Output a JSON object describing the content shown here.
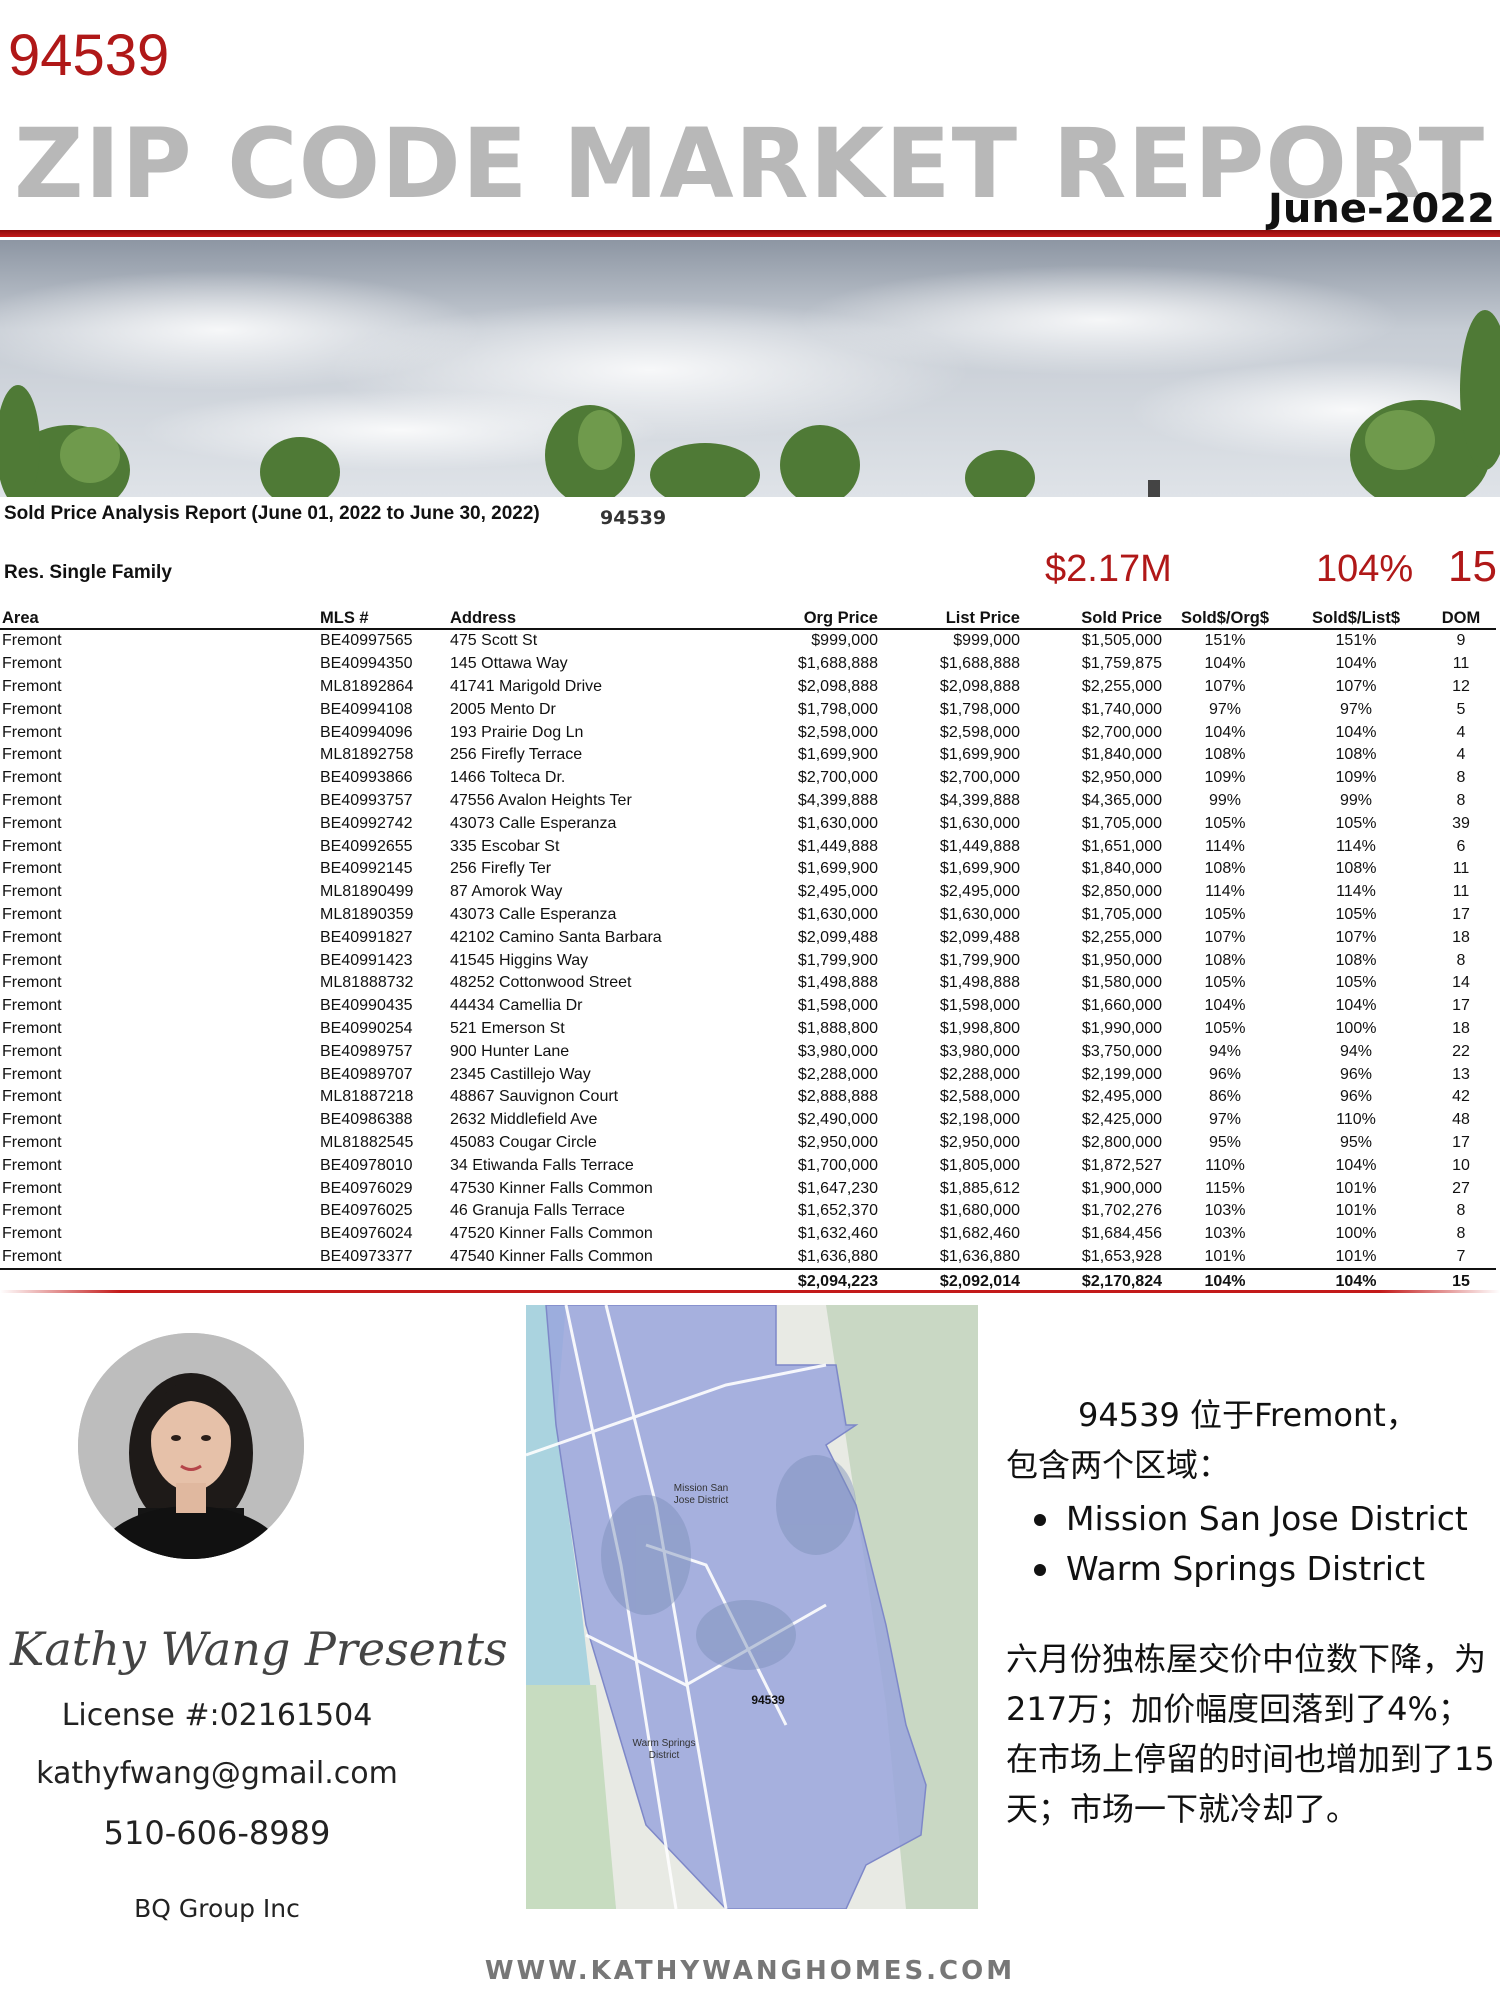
{
  "header": {
    "zip": "94539",
    "title": "ZIP CODE MARKET REPORT",
    "date": "June-2022"
  },
  "report": {
    "title": "Sold Price Analysis Report (June 01, 2022 to June 30, 2022)",
    "zip": "94539",
    "segment": "Res. Single Family",
    "highlights": {
      "median_price": "$2.17M",
      "sold_over_list": "104%",
      "dom": "15"
    },
    "columns": [
      "Area",
      "MLS #",
      "Address",
      "Org Price",
      "List Price",
      "Sold Price",
      "Sold$/Org$",
      "Sold$/List$",
      "DOM"
    ],
    "rows": [
      [
        "Fremont",
        "BE40997565",
        "475 Scott St",
        "$999,000",
        "$999,000",
        "$1,505,000",
        "151%",
        "151%",
        "9"
      ],
      [
        "Fremont",
        "BE40994350",
        "145 Ottawa Way",
        "$1,688,888",
        "$1,688,888",
        "$1,759,875",
        "104%",
        "104%",
        "11"
      ],
      [
        "Fremont",
        "ML81892864",
        "41741 Marigold Drive",
        "$2,098,888",
        "$2,098,888",
        "$2,255,000",
        "107%",
        "107%",
        "12"
      ],
      [
        "Fremont",
        "BE40994108",
        "2005 Mento Dr",
        "$1,798,000",
        "$1,798,000",
        "$1,740,000",
        "97%",
        "97%",
        "5"
      ],
      [
        "Fremont",
        "BE40994096",
        "193 Prairie Dog Ln",
        "$2,598,000",
        "$2,598,000",
        "$2,700,000",
        "104%",
        "104%",
        "4"
      ],
      [
        "Fremont",
        "ML81892758",
        "256 Firefly Terrace",
        "$1,699,900",
        "$1,699,900",
        "$1,840,000",
        "108%",
        "108%",
        "4"
      ],
      [
        "Fremont",
        "BE40993866",
        "1466 Tolteca Dr.",
        "$2,700,000",
        "$2,700,000",
        "$2,950,000",
        "109%",
        "109%",
        "8"
      ],
      [
        "Fremont",
        "BE40993757",
        "47556 Avalon Heights Ter",
        "$4,399,888",
        "$4,399,888",
        "$4,365,000",
        "99%",
        "99%",
        "8"
      ],
      [
        "Fremont",
        "BE40992742",
        "43073 Calle Esperanza",
        "$1,630,000",
        "$1,630,000",
        "$1,705,000",
        "105%",
        "105%",
        "39"
      ],
      [
        "Fremont",
        "BE40992655",
        "335 Escobar St",
        "$1,449,888",
        "$1,449,888",
        "$1,651,000",
        "114%",
        "114%",
        "6"
      ],
      [
        "Fremont",
        "BE40992145",
        "256 Firefly Ter",
        "$1,699,900",
        "$1,699,900",
        "$1,840,000",
        "108%",
        "108%",
        "11"
      ],
      [
        "Fremont",
        "ML81890499",
        "87 Amorok Way",
        "$2,495,000",
        "$2,495,000",
        "$2,850,000",
        "114%",
        "114%",
        "11"
      ],
      [
        "Fremont",
        "ML81890359",
        "43073 Calle Esperanza",
        "$1,630,000",
        "$1,630,000",
        "$1,705,000",
        "105%",
        "105%",
        "17"
      ],
      [
        "Fremont",
        "BE40991827",
        "42102 Camino Santa Barbara",
        "$2,099,488",
        "$2,099,488",
        "$2,255,000",
        "107%",
        "107%",
        "18"
      ],
      [
        "Fremont",
        "BE40991423",
        "41545 Higgins Way",
        "$1,799,900",
        "$1,799,900",
        "$1,950,000",
        "108%",
        "108%",
        "8"
      ],
      [
        "Fremont",
        "ML81888732",
        "48252 Cottonwood Street",
        "$1,498,888",
        "$1,498,888",
        "$1,580,000",
        "105%",
        "105%",
        "14"
      ],
      [
        "Fremont",
        "BE40990435",
        "44434 Camellia Dr",
        "$1,598,000",
        "$1,598,000",
        "$1,660,000",
        "104%",
        "104%",
        "17"
      ],
      [
        "Fremont",
        "BE40990254",
        "521 Emerson St",
        "$1,888,800",
        "$1,998,800",
        "$1,990,000",
        "105%",
        "100%",
        "18"
      ],
      [
        "Fremont",
        "BE40989757",
        "900 Hunter Lane",
        "$3,980,000",
        "$3,980,000",
        "$3,750,000",
        "94%",
        "94%",
        "22"
      ],
      [
        "Fremont",
        "BE40989707",
        "2345 Castillejo Way",
        "$2,288,000",
        "$2,288,000",
        "$2,199,000",
        "96%",
        "96%",
        "13"
      ],
      [
        "Fremont",
        "ML81887218",
        "48867 Sauvignon Court",
        "$2,888,888",
        "$2,588,000",
        "$2,495,000",
        "86%",
        "96%",
        "42"
      ],
      [
        "Fremont",
        "BE40986388",
        "2632 Middlefield Ave",
        "$2,490,000",
        "$2,198,000",
        "$2,425,000",
        "97%",
        "110%",
        "48"
      ],
      [
        "Fremont",
        "ML81882545",
        "45083 Cougar Circle",
        "$2,950,000",
        "$2,950,000",
        "$2,800,000",
        "95%",
        "95%",
        "17"
      ],
      [
        "Fremont",
        "BE40978010",
        "34 Etiwanda Falls Terrace",
        "$1,700,000",
        "$1,805,000",
        "$1,872,527",
        "110%",
        "104%",
        "10"
      ],
      [
        "Fremont",
        "BE40976029",
        "47530 Kinner Falls Common",
        "$1,647,230",
        "$1,885,612",
        "$1,900,000",
        "115%",
        "101%",
        "27"
      ],
      [
        "Fremont",
        "BE40976025",
        "46 Granuja Falls Terrace",
        "$1,652,370",
        "$1,680,000",
        "$1,702,276",
        "103%",
        "101%",
        "8"
      ],
      [
        "Fremont",
        "BE40976024",
        "47520 Kinner Falls Common",
        "$1,632,460",
        "$1,682,460",
        "$1,684,456",
        "103%",
        "100%",
        "8"
      ],
      [
        "Fremont",
        "BE40973377",
        "47540 Kinner Falls Common",
        "$1,636,880",
        "$1,636,880",
        "$1,653,928",
        "101%",
        "101%",
        "7"
      ]
    ],
    "totals": [
      "",
      "",
      "",
      "$2,094,223",
      "$2,092,014",
      "$2,170,824",
      "104%",
      "104%",
      "15"
    ]
  },
  "agent": {
    "signature": "Kathy Wang Presents",
    "license": "License #:02161504",
    "email": "kathyfwang@gmail.com",
    "phone": "510-606-8989",
    "company": "BQ Group Inc"
  },
  "map": {
    "labels": {
      "district1": [
        "Mission San",
        "Jose District"
      ],
      "zip": "94539",
      "district2": [
        "Warm Springs",
        "District"
      ]
    },
    "colors": {
      "boundary_fill": "#9aa6dd",
      "water": "#aad3df",
      "land": "#e9ebe6"
    }
  },
  "description": {
    "intro_line1": "94539 位于Fremont，",
    "intro_line2": "包含两个区域：",
    "districts": [
      "Mission San Jose District",
      "Warm Springs District"
    ],
    "summary": "六月份独栋屋交价中位数下降，为217万；加价幅度回落到了4%；在市场上停留的时间也增加到了15天；市场一下就冷却了。"
  },
  "footer": {
    "website": "WWW.KATHYWANGHOMES.COM"
  },
  "colors": {
    "accent_red": "#b01818",
    "title_gray": "#b8b8b8"
  }
}
